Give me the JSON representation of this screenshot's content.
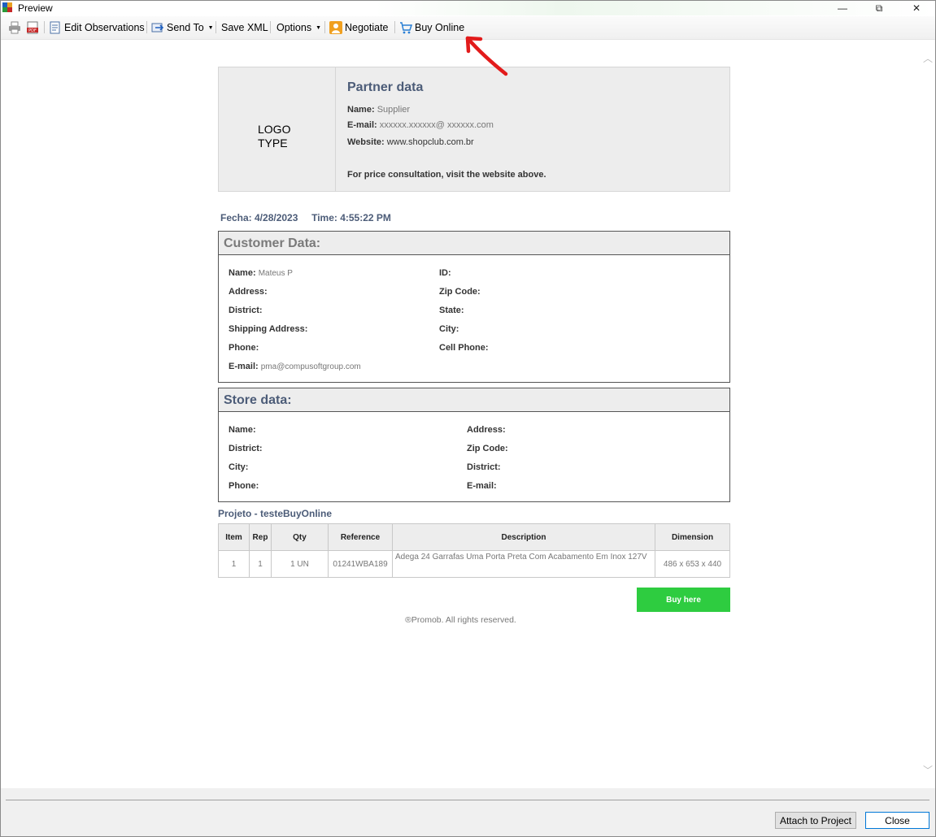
{
  "window": {
    "title": "Preview",
    "minimize": "—",
    "restore": "⧉",
    "close": "✕"
  },
  "toolbar": {
    "edit_observations": "Edit Observations",
    "send_to": "Send To",
    "save_xml": "Save XML",
    "options": "Options",
    "negotiate": "Negotiate",
    "buy_online": "Buy Online"
  },
  "partner": {
    "logo_line1": "LOGO",
    "logo_line2": "TYPE",
    "title": "Partner data",
    "name_label": "Name:",
    "name_value": "Supplier",
    "email_label": "E-mail:",
    "email_value": "xxxxxx.xxxxxx@ xxxxxx.com",
    "website_label": "Website:",
    "website_value": "www.shopclub.com.br",
    "note": "For price consultation, visit the website above."
  },
  "date": {
    "fecha": "Fecha: 4/28/2023",
    "time": "Time: 4:55:22 PM"
  },
  "customer": {
    "header": "Customer Data:",
    "name_label": "Name:",
    "name_value": "Mateus P",
    "id_label": "ID:",
    "address_label": "Address:",
    "zip_label": "Zip Code:",
    "district_label": "District:",
    "state_label": "State:",
    "shipping_label": "Shipping Address:",
    "city_label": "City:",
    "phone_label": "Phone:",
    "cell_label": "Cell Phone:",
    "email_label": "E-mail:",
    "email_value": "pma@compusoftgroup.com"
  },
  "store": {
    "header": "Store data:",
    "name_label": "Name:",
    "address_label": "Address:",
    "district_label": "District:",
    "zip_label": "Zip Code:",
    "city_label": "City:",
    "district2_label": "District:",
    "phone_label": "Phone:",
    "email_label": "E-mail:"
  },
  "project": {
    "title": "Projeto - testeBuyOnline"
  },
  "table": {
    "headers": [
      "Item",
      "Rep",
      "Qty",
      "Reference",
      "Description",
      "Dimension"
    ],
    "rows": [
      [
        "1",
        "1",
        "1 UN",
        "01241WBA189",
        "Adega 24 Garrafas Uma Porta Preta Com Acabamento Em Inox 127V",
        "486 x 653 x 440"
      ]
    ]
  },
  "buy_here": "Buy here",
  "footer": "®Promob. All rights reserved.",
  "buttons": {
    "attach": "Attach to Project",
    "close": "Close"
  },
  "colors": {
    "accent_text": "#4c5c78",
    "buy_button": "#2ecc40",
    "arrow": "#e21b1b"
  }
}
